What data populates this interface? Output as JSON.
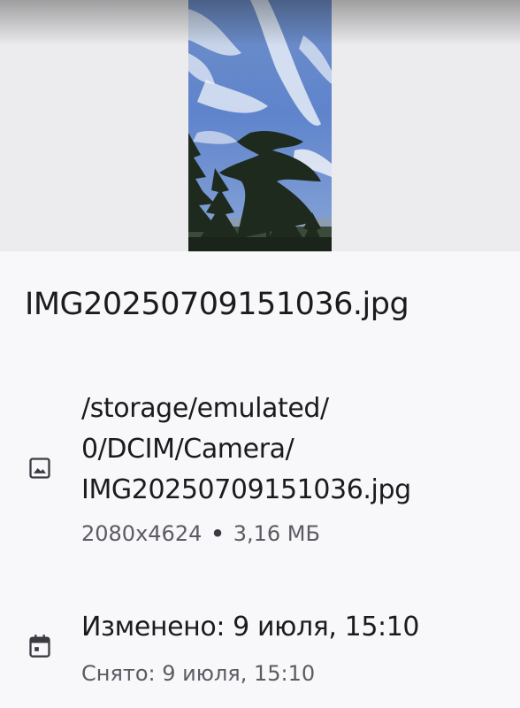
{
  "preview": {
    "image_icon": "photo-thumbnail"
  },
  "file": {
    "name": "IMG20250709151036.jpg",
    "path_lines": [
      "/storage/emulated/",
      "0/DCIM/Camera/",
      "IMG20250709151036.jpg"
    ],
    "resolution": "2080x4624",
    "separator": "•",
    "size": "3,16 МБ",
    "path_icon": "image-icon"
  },
  "dates": {
    "icon": "calendar-icon",
    "modified": "Изменено: 9 июля, 15:10",
    "taken": "Снято: 9 июля, 15:10"
  }
}
